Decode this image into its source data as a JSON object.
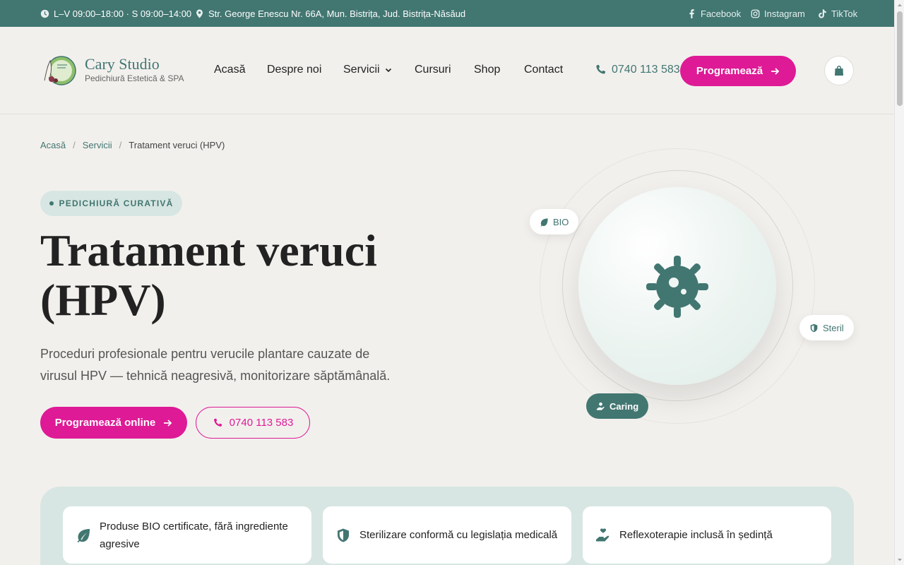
{
  "topbar": {
    "hours": "L–V 09:00–18:00 · S 09:00–14:00",
    "address": "Str. George Enescu Nr. 66A, Mun. Bistrița, Jud. Bistrița-Năsăud",
    "social": [
      "Facebook",
      "Instagram",
      "TikTok"
    ]
  },
  "brand": {
    "name": "Cary Studio",
    "tagline": "Pedichiură Estetică & SPA"
  },
  "nav": {
    "items": [
      "Acasă",
      "Despre noi",
      "Servicii",
      "Cursuri",
      "Shop",
      "Contact"
    ]
  },
  "header": {
    "phone": "0740 113 583",
    "cta": "Programează"
  },
  "breadcrumb": {
    "home": "Acasă",
    "section": "Servicii",
    "current": "Tratament veruci (HPV)"
  },
  "hero": {
    "badge": "PEDICHIURĂ CURATIVĂ",
    "title_line1": "Tratament veruci",
    "title_line2": "(HPV)",
    "description": "Proceduri profesionale pentru verucile plantare cauzate de virusul HPV — tehnică neagresivă, monitorizare săptămânală.",
    "cta_primary": "Programează online",
    "cta_phone": "0740 113 583"
  },
  "visual": {
    "pills": [
      "BIO",
      "Steril",
      "Caring"
    ]
  },
  "features": [
    "Produse BIO certificate, fără ingrediente agresive",
    "Sterilizare conformă cu legislația medicală",
    "Reflexoterapie inclusă în ședință"
  ],
  "colors": {
    "primary_green": "#427671",
    "accent_pink": "#de1a96",
    "mint": "#d7e6e2",
    "background": "#f2f0ed"
  }
}
